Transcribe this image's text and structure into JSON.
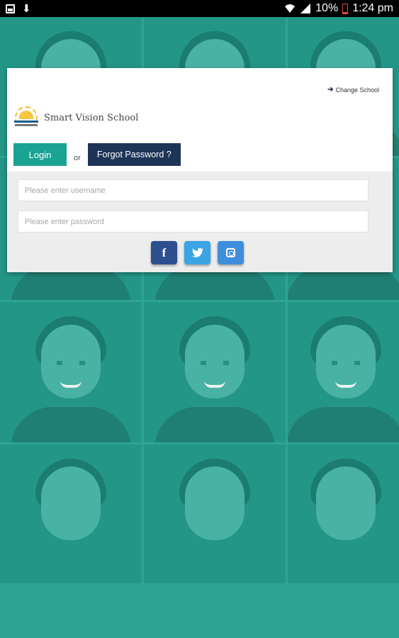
{
  "status_bar": {
    "battery_percent": "10%",
    "time": "1:24 pm",
    "icons": [
      "image-icon",
      "download-icon",
      "wifi-icon",
      "signal-icon",
      "battery-low-icon"
    ],
    "battery_color": "#e84c3d"
  },
  "card": {
    "change_school_label": "Change School",
    "school_name": "Smart Vision School",
    "login_label": "Login",
    "or_label": "or",
    "forgot_label": "Forgot Password ?",
    "username_placeholder": "Please enter username",
    "password_placeholder": "Please enter password",
    "social": [
      {
        "name": "facebook",
        "icon": "facebook-icon",
        "color": "#2d4f8f"
      },
      {
        "name": "twitter",
        "icon": "twitter-icon",
        "color": "#3ba4e4"
      },
      {
        "name": "instagram",
        "icon": "instagram-icon",
        "color": "#3f8edc"
      }
    ]
  },
  "colors": {
    "background_teal": "#1d9a8c",
    "login_button": "#1aa393",
    "forgot_button": "#1e3457"
  }
}
